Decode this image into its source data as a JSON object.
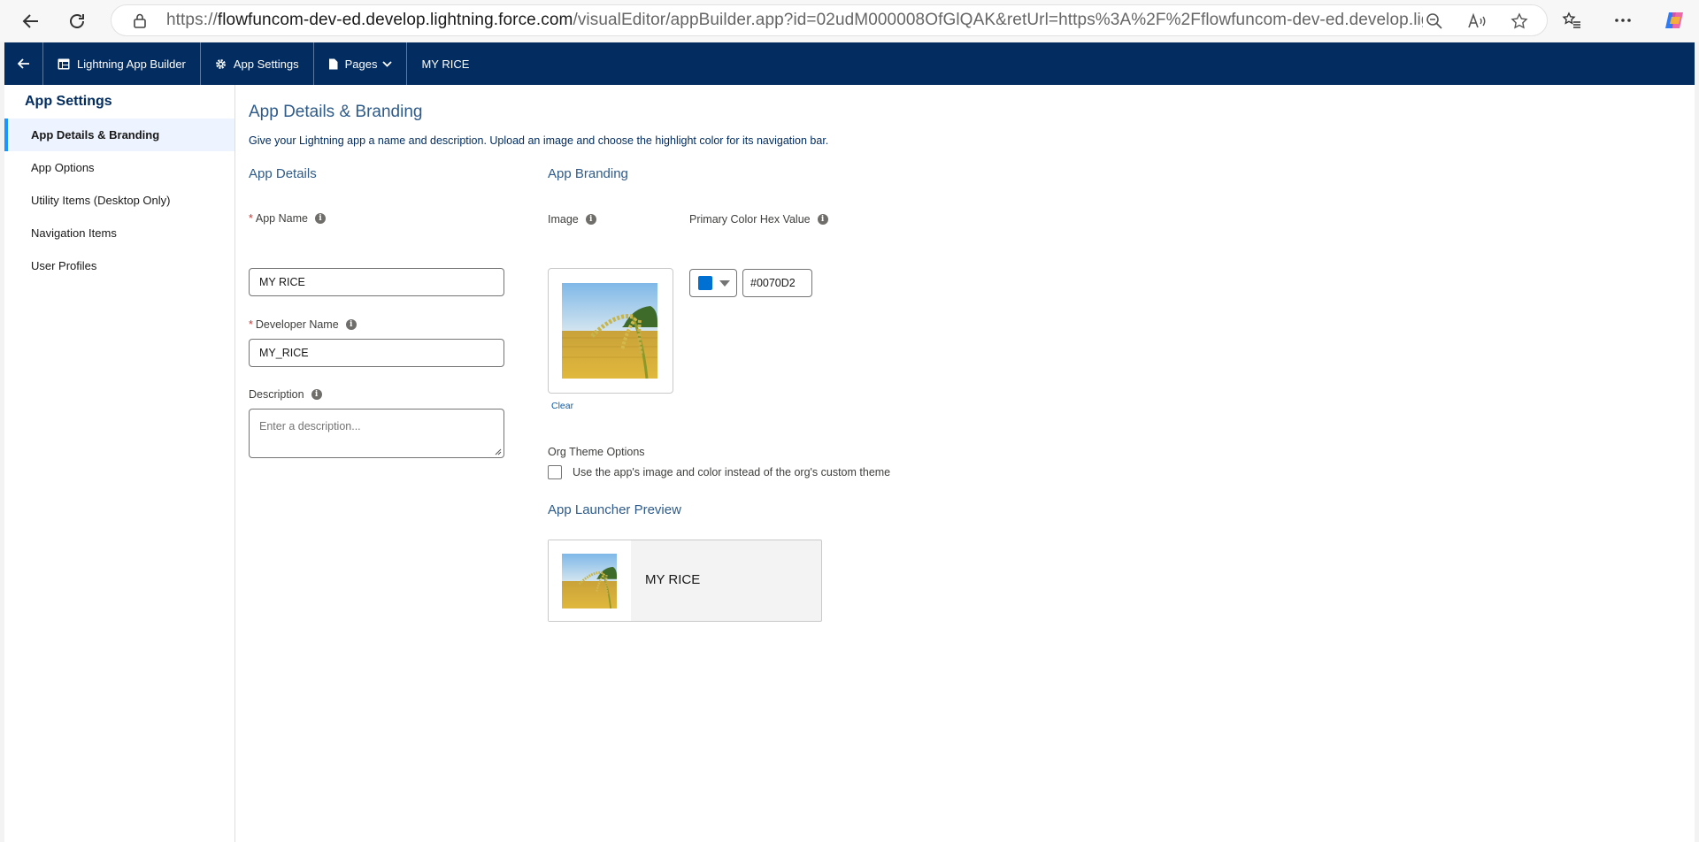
{
  "browser": {
    "url_prefix": "https://",
    "url_host": "flowfuncom-dev-ed.develop.lightning.force.com",
    "url_rest": "/visualEditor/appBuilder.app?id=02udM000008OfGlQAK&retUrl=https%3A%2F%2Fflowfuncom-dev-ed.develop.lightning.for..."
  },
  "topnav": {
    "builder": "Lightning App Builder",
    "settings": "App Settings",
    "pages": "Pages",
    "app_name": "MY RICE"
  },
  "sidebar": {
    "title": "App Settings",
    "items": [
      {
        "label": "App Details & Branding"
      },
      {
        "label": "App Options"
      },
      {
        "label": "Utility Items (Desktop Only)"
      },
      {
        "label": "Navigation Items"
      },
      {
        "label": "User Profiles"
      }
    ]
  },
  "main": {
    "title": "App Details & Branding",
    "description": "Give your Lightning app a name and description. Upload an image and choose the highlight color for its navigation bar.",
    "details": {
      "heading": "App Details",
      "app_name_label": "App Name",
      "app_name_value": "MY RICE",
      "dev_name_label": "Developer Name",
      "dev_name_value": "MY_RICE",
      "description_label": "Description",
      "description_placeholder": "Enter a description..."
    },
    "branding": {
      "heading": "App Branding",
      "image_label": "Image",
      "clear_link": "Clear",
      "color_label": "Primary Color Hex Value",
      "color_value": "#0070D2",
      "org_theme_label": "Org Theme Options",
      "org_theme_checkbox": "Use the app's image and color instead of the org's custom theme",
      "org_theme_checked": false
    },
    "preview": {
      "heading": "App Launcher Preview",
      "app_name": "MY RICE"
    }
  },
  "colors": {
    "nav_bg": "#032d60",
    "accent": "#1b96ff",
    "primary_color": "#0070d2"
  }
}
